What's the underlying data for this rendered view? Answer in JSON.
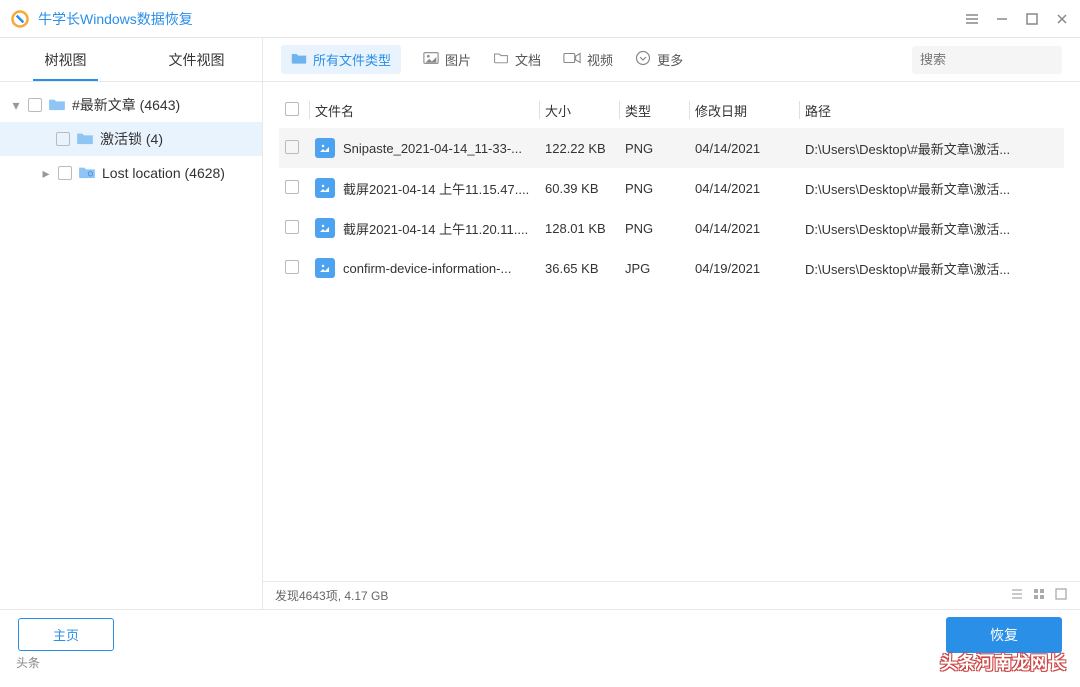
{
  "titlebar": {
    "app_title": "牛学长Windows数据恢复"
  },
  "sidebar": {
    "tabs": {
      "tree": "树视图",
      "file": "文件视图"
    },
    "nodes": [
      {
        "label": "#最新文章  (4643)"
      },
      {
        "label": "激活锁  (4)"
      },
      {
        "label": "Lost location  (4628)"
      }
    ]
  },
  "toolbar": {
    "all": "所有文件类型",
    "image": "图片",
    "doc": "文档",
    "video": "视频",
    "more": "更多",
    "search_placeholder": "搜索"
  },
  "table": {
    "headers": {
      "name": "文件名",
      "size": "大小",
      "type": "类型",
      "date": "修改日期",
      "path": "路径"
    },
    "rows": [
      {
        "name": "Snipaste_2021-04-14_11-33-...",
        "size": "122.22 KB",
        "type": "PNG",
        "date": "04/14/2021",
        "path": "D:\\Users\\Desktop\\#最新文章\\激活..."
      },
      {
        "name": "截屏2021-04-14 上午11.15.47....",
        "size": "60.39 KB",
        "type": "PNG",
        "date": "04/14/2021",
        "path": "D:\\Users\\Desktop\\#最新文章\\激活..."
      },
      {
        "name": "截屏2021-04-14 上午11.20.11....",
        "size": "128.01 KB",
        "type": "PNG",
        "date": "04/14/2021",
        "path": "D:\\Users\\Desktop\\#最新文章\\激活..."
      },
      {
        "name": "confirm-device-information-...",
        "size": "36.65 KB",
        "type": "JPG",
        "date": "04/19/2021",
        "path": "D:\\Users\\Desktop\\#最新文章\\激活..."
      }
    ]
  },
  "statusbar": {
    "text": "发现4643项, 4.17 GB"
  },
  "bottombar": {
    "home": "主页",
    "recover": "恢复"
  },
  "watermark": {
    "right": "头条河南龙网长",
    "left": "头条"
  }
}
